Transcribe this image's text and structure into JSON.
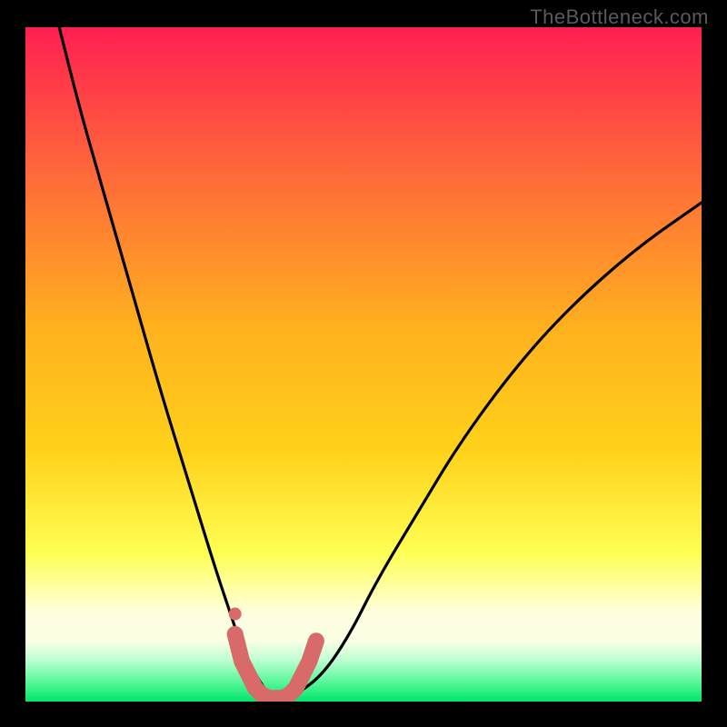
{
  "watermark": "TheBottleneck.com",
  "colors": {
    "gradient_top": "#ff1f52",
    "gradient_mid_upper": "#ff7a2d",
    "gradient_mid": "#ffd21a",
    "gradient_lower": "#ffff70",
    "gradient_white": "#ffffe0",
    "gradient_green_light": "#8cffb0",
    "gradient_green": "#00e66a",
    "curve": "#000000",
    "marker": "#d86a6a",
    "frame": "#000000"
  },
  "chart_data": {
    "type": "line",
    "title": "",
    "xlabel": "",
    "ylabel": "",
    "xlim": [
      0,
      100
    ],
    "ylim": [
      0,
      100
    ],
    "series": [
      {
        "name": "bottleneck-curve",
        "x": [
          5,
          8,
          12,
          16,
          20,
          24,
          28,
          30,
          32,
          34,
          36,
          38,
          40,
          44,
          48,
          52,
          58,
          64,
          72,
          80,
          90,
          100
        ],
        "y": [
          100,
          88,
          74,
          60,
          46,
          33,
          20,
          14,
          8,
          4,
          1,
          0,
          1,
          4,
          10,
          18,
          28,
          38,
          49,
          58,
          67,
          74
        ]
      }
    ],
    "annotations": [
      {
        "name": "highlighted-segment",
        "type": "polyline-marker",
        "x": [
          31,
          32,
          33,
          34,
          35,
          36,
          37,
          38,
          39,
          40,
          41,
          42,
          43
        ],
        "y": [
          10,
          6,
          4,
          2,
          1,
          0.5,
          0.5,
          0.5,
          1,
          2,
          4,
          6,
          9
        ]
      },
      {
        "name": "marker-dot",
        "type": "point",
        "x": 31,
        "y": 13
      }
    ],
    "background": "vertical-gradient"
  }
}
